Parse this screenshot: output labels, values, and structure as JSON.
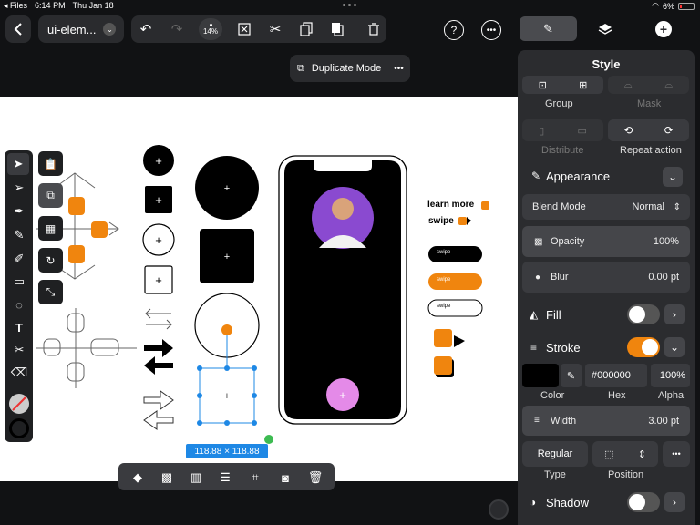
{
  "status": {
    "back_app": "Files",
    "time": "6:14 PM",
    "date": "Thu Jan 18",
    "battery": "6%"
  },
  "toolbar": {
    "doc_title": "ui-elem...",
    "zoom": "14%",
    "duplicate_mode": "Duplicate Mode"
  },
  "canvas": {
    "learn_more": "learn more",
    "swipe": "swipe",
    "swipe_btn": "swipe",
    "selection_size": "118.88 × 118.88"
  },
  "panel": {
    "title": "Style",
    "group": "Group",
    "mask": "Mask",
    "distribute": "Distribute",
    "repeat_action": "Repeat action",
    "appearance": "Appearance",
    "blend_mode_label": "Blend Mode",
    "blend_mode_value": "Normal",
    "opacity_label": "Opacity",
    "opacity_value": "100%",
    "blur_label": "Blur",
    "blur_value": "0.00 pt",
    "fill": "Fill",
    "stroke": "Stroke",
    "hex_value": "#000000",
    "alpha_value": "100%",
    "color_label": "Color",
    "hex_label": "Hex",
    "alpha_label": "Alpha",
    "width_label": "Width",
    "width_value": "3.00 pt",
    "stroke_type_value": "Regular",
    "type_label": "Type",
    "position_label": "Position",
    "shadow": "Shadow"
  },
  "colors": {
    "accent": "#f0850e",
    "selection": "#1e88e5",
    "panel": "#2b2c2f"
  }
}
